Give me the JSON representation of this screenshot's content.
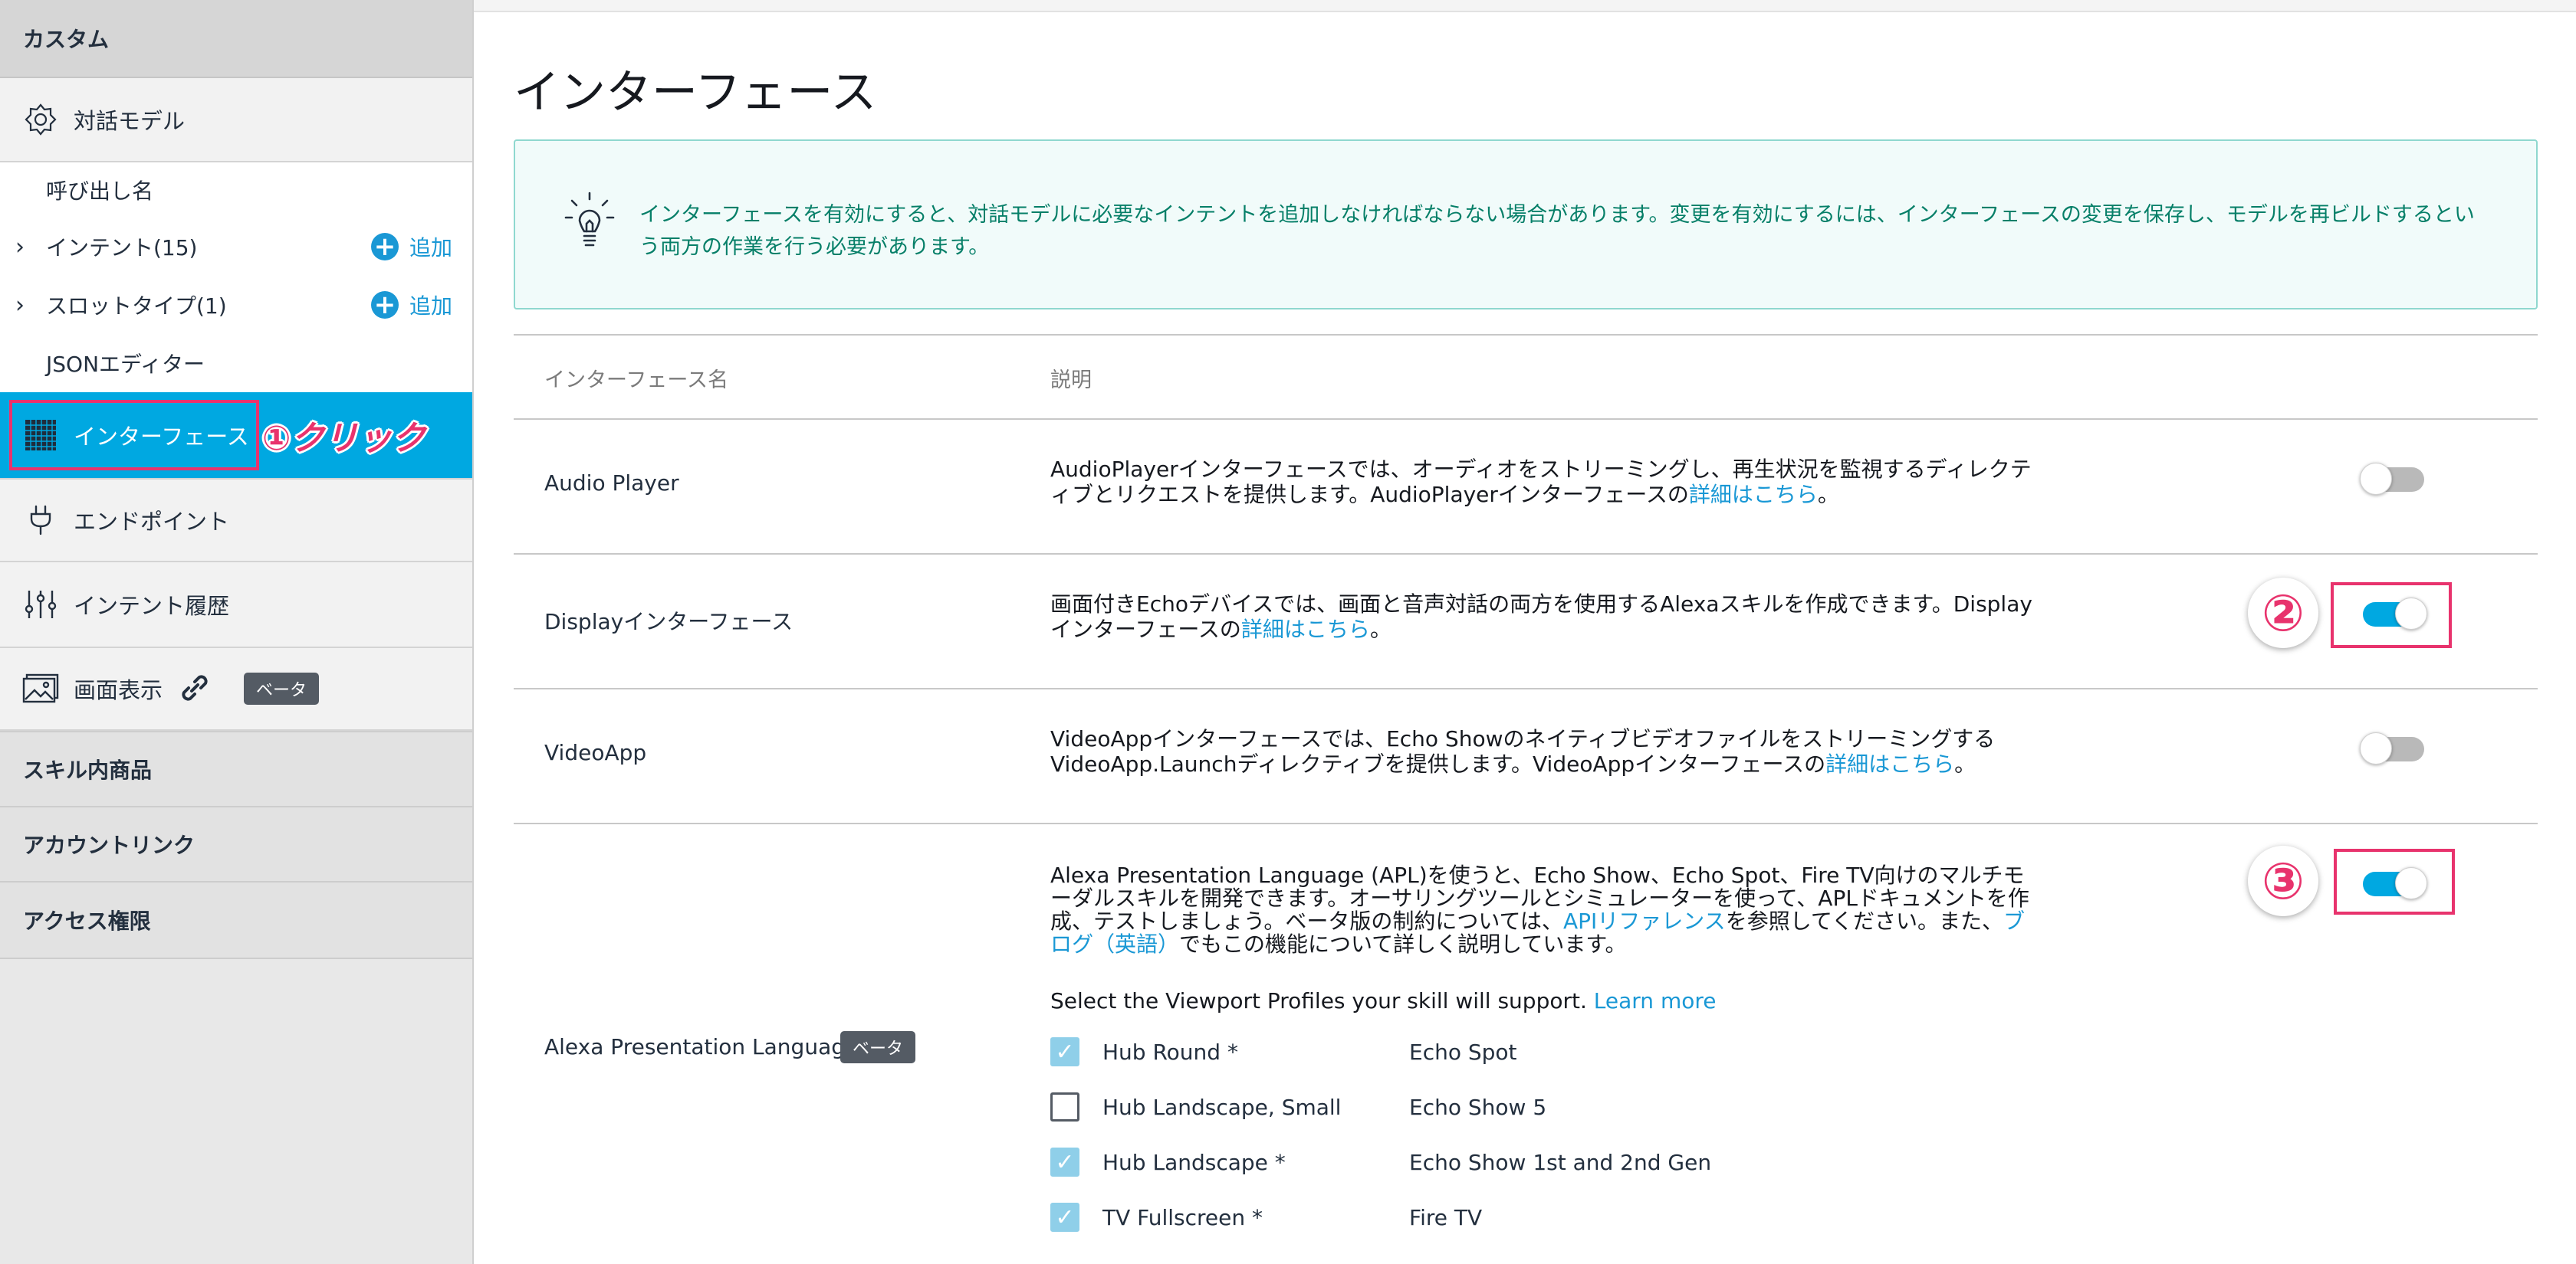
{
  "sidebar": {
    "section_custom": "カスタム",
    "items": {
      "model": "対話モデル",
      "invocation": "呼び出し名",
      "intents": "インテント(15)",
      "slot_types": "スロットタイプ(1)",
      "json_editor": "JSONエディター",
      "interface": "インターフェース",
      "endpoint": "エンドポイント",
      "intent_history": "インテント履歴",
      "display": "画面表示",
      "beta": "ベータ"
    },
    "add_label": "追加",
    "section_isp": "スキル内商品",
    "section_account_link": "アカウントリンク",
    "section_permissions": "アクセス権限"
  },
  "annotations": {
    "click_label": "①クリック",
    "step2": "②",
    "step3": "③"
  },
  "main": {
    "title": "インターフェース",
    "info_text": "インターフェースを有効にすると、対話モデルに必要なインテントを追加しなければならない場合があります。変更を有効にするには、インターフェースの変更を保存し、モデルを再ビルドするという両方の作業を行う必要があります。",
    "table": {
      "col_name": "インターフェース名",
      "col_desc": "説明",
      "rows": [
        {
          "name": "Audio Player",
          "desc_pre": "AudioPlayerインターフェースでは、オーディオをストリーミングし、再生状況を監視するディレクティブとリクエストを提供します。AudioPlayerインターフェースの",
          "link": "詳細はこちら",
          "desc_post": "。",
          "enabled": false
        },
        {
          "name": "Displayインターフェース",
          "desc_pre": "画面付きEchoデバイスでは、画面と音声対話の両方を使用するAlexaスキルを作成できます。Displayインターフェースの",
          "link": "詳細はこちら",
          "desc_post": "。",
          "enabled": true
        },
        {
          "name": "VideoApp",
          "desc_pre": "VideoAppインターフェースでは、Echo Showのネイティブビデオファイルをストリーミングする VideoApp.Launchディレクティブを提供します。VideoAppインターフェースの",
          "link": "詳細はこちら",
          "desc_post": "。",
          "enabled": false
        }
      ],
      "apl": {
        "name": "Alexa Presentation Language",
        "beta": "ベータ",
        "desc_pre": "Alexa Presentation Language (APL)を使うと、Echo Show、Echo Spot、Fire TV向けのマルチモーダルスキルを開発できます。オーサリングツールとシミュレーターを使って、APLドキュメントを作成、テストしましょう。ベータ版の制約については、",
        "link1": "APIリファレンス",
        "desc_mid": "を参照してください。また、",
        "link2": "ブログ（英語）",
        "desc_post": "でもこの機能について詳しく説明しています。",
        "viewport_prompt": "Select the Viewport Profiles your skill will support.",
        "learn_more": "Learn more",
        "enabled": true,
        "viewports": [
          {
            "label": "Hub Round *",
            "device": "Echo Spot",
            "checked": true
          },
          {
            "label": "Hub Landscape, Small",
            "device": "Echo Show 5",
            "checked": false
          },
          {
            "label": "Hub Landscape *",
            "device": "Echo Show 1st and 2nd Gen",
            "checked": true
          },
          {
            "label": "TV Fullscreen *",
            "device": "Fire TV",
            "checked": true
          }
        ]
      }
    }
  },
  "colors": {
    "accent": "#00a8e1",
    "link": "#1a98d5",
    "annotation": "#e8336d",
    "info_text": "#067f68"
  }
}
